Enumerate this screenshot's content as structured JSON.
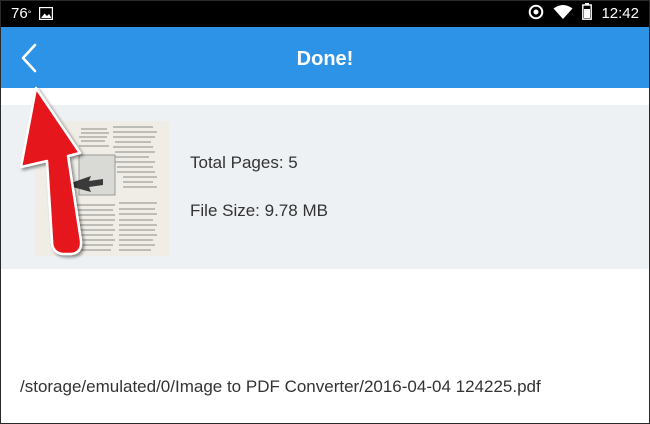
{
  "status_bar": {
    "left_number": "76",
    "left_unit": "°",
    "time": "12:42",
    "icons": [
      "image-notification-icon",
      "data-saver-icon",
      "wifi-icon",
      "battery-icon"
    ]
  },
  "toolbar": {
    "title": "Done!",
    "back_icon": "chevron-left-icon",
    "color": "#2d93e6"
  },
  "result_card": {
    "total_pages_label": "Total Pages: 5",
    "file_size_label": "File Size: 9.78 MB",
    "thumbnail": "pdf-page-thumbnail"
  },
  "file_path": "/storage/emulated/0/Image to PDF Converter/2016-04-04 124225.pdf",
  "annotation": {
    "type": "red-arrow",
    "color": "#e5141b",
    "points_to": "back-button"
  }
}
